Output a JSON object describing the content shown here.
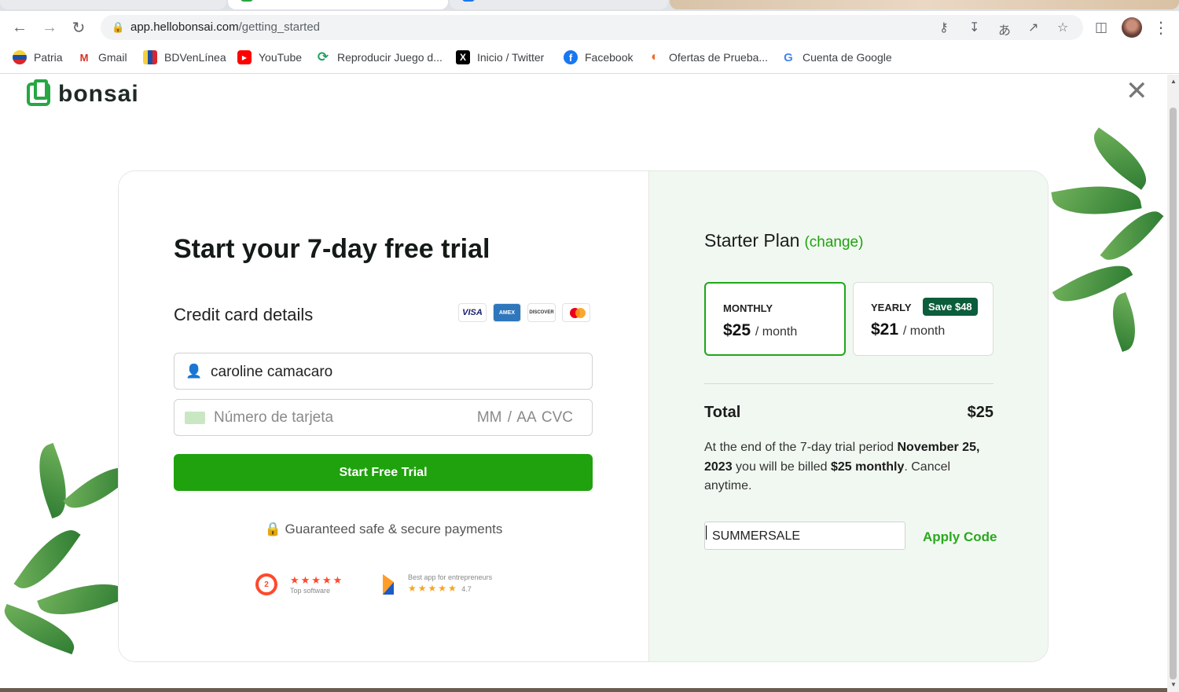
{
  "browser": {
    "url_domain": "app.hellobonsai.com",
    "url_path": "/getting_started",
    "bookmarks": [
      {
        "label": "Patria",
        "icon": "patria-icon"
      },
      {
        "label": "Gmail",
        "icon": "gmail-icon"
      },
      {
        "label": "BDVenLínea",
        "icon": "bdv-icon"
      },
      {
        "label": "YouTube",
        "icon": "youtube-icon"
      },
      {
        "label": "Reproducir Juego d...",
        "icon": "game-icon"
      },
      {
        "label": "Inicio / Twitter",
        "icon": "x-twitter-icon"
      },
      {
        "label": "Facebook",
        "icon": "facebook-icon"
      },
      {
        "label": "Ofertas de Prueba...",
        "icon": "offers-icon"
      },
      {
        "label": "Cuenta de Google",
        "icon": "google-icon"
      }
    ]
  },
  "brand": {
    "name": "bonsai",
    "color": "#26a744"
  },
  "trial": {
    "heading": "Start your 7-day free trial",
    "cc_title": "Credit card details",
    "card_logos": [
      "VISA",
      "AMEX",
      "DISCOVER",
      "mastercard"
    ],
    "name_value": "caroline camacaro",
    "card_placeholder": "Número de tarjeta",
    "expiry_cvc_placeholder": "MM / AA  CVC",
    "submit_label": "Start Free Trial",
    "secure_text": "Guaranteed safe & secure payments",
    "g2": {
      "logo": "2",
      "stars": "★★★★★",
      "caption": "Top software"
    },
    "capterra": {
      "caption": "Best app for entrepreneurs",
      "stars": "★★★★★",
      "rating": "4.7"
    }
  },
  "plan": {
    "title": "Starter Plan",
    "change_label": "(change)",
    "monthly": {
      "label": "MONTHLY",
      "price": "$25",
      "per": "/ month"
    },
    "yearly": {
      "label": "YEARLY",
      "price": "$21",
      "per": "/ month",
      "save": "Save $48"
    },
    "total_label": "Total",
    "total_value": "$25",
    "note_part1": "At the end of the 7-day trial period ",
    "note_date": "November 25, 2023",
    "note_part2": " you will be billed ",
    "note_amount": "$25 monthly",
    "note_part3": ". Cancel anytime.",
    "promo_value": "SUMMERSALE",
    "apply_label": "Apply Code"
  },
  "colors": {
    "accent": "#1fa20d",
    "panel": "#f1f8f1",
    "save_badge": "#0b5d3b"
  }
}
